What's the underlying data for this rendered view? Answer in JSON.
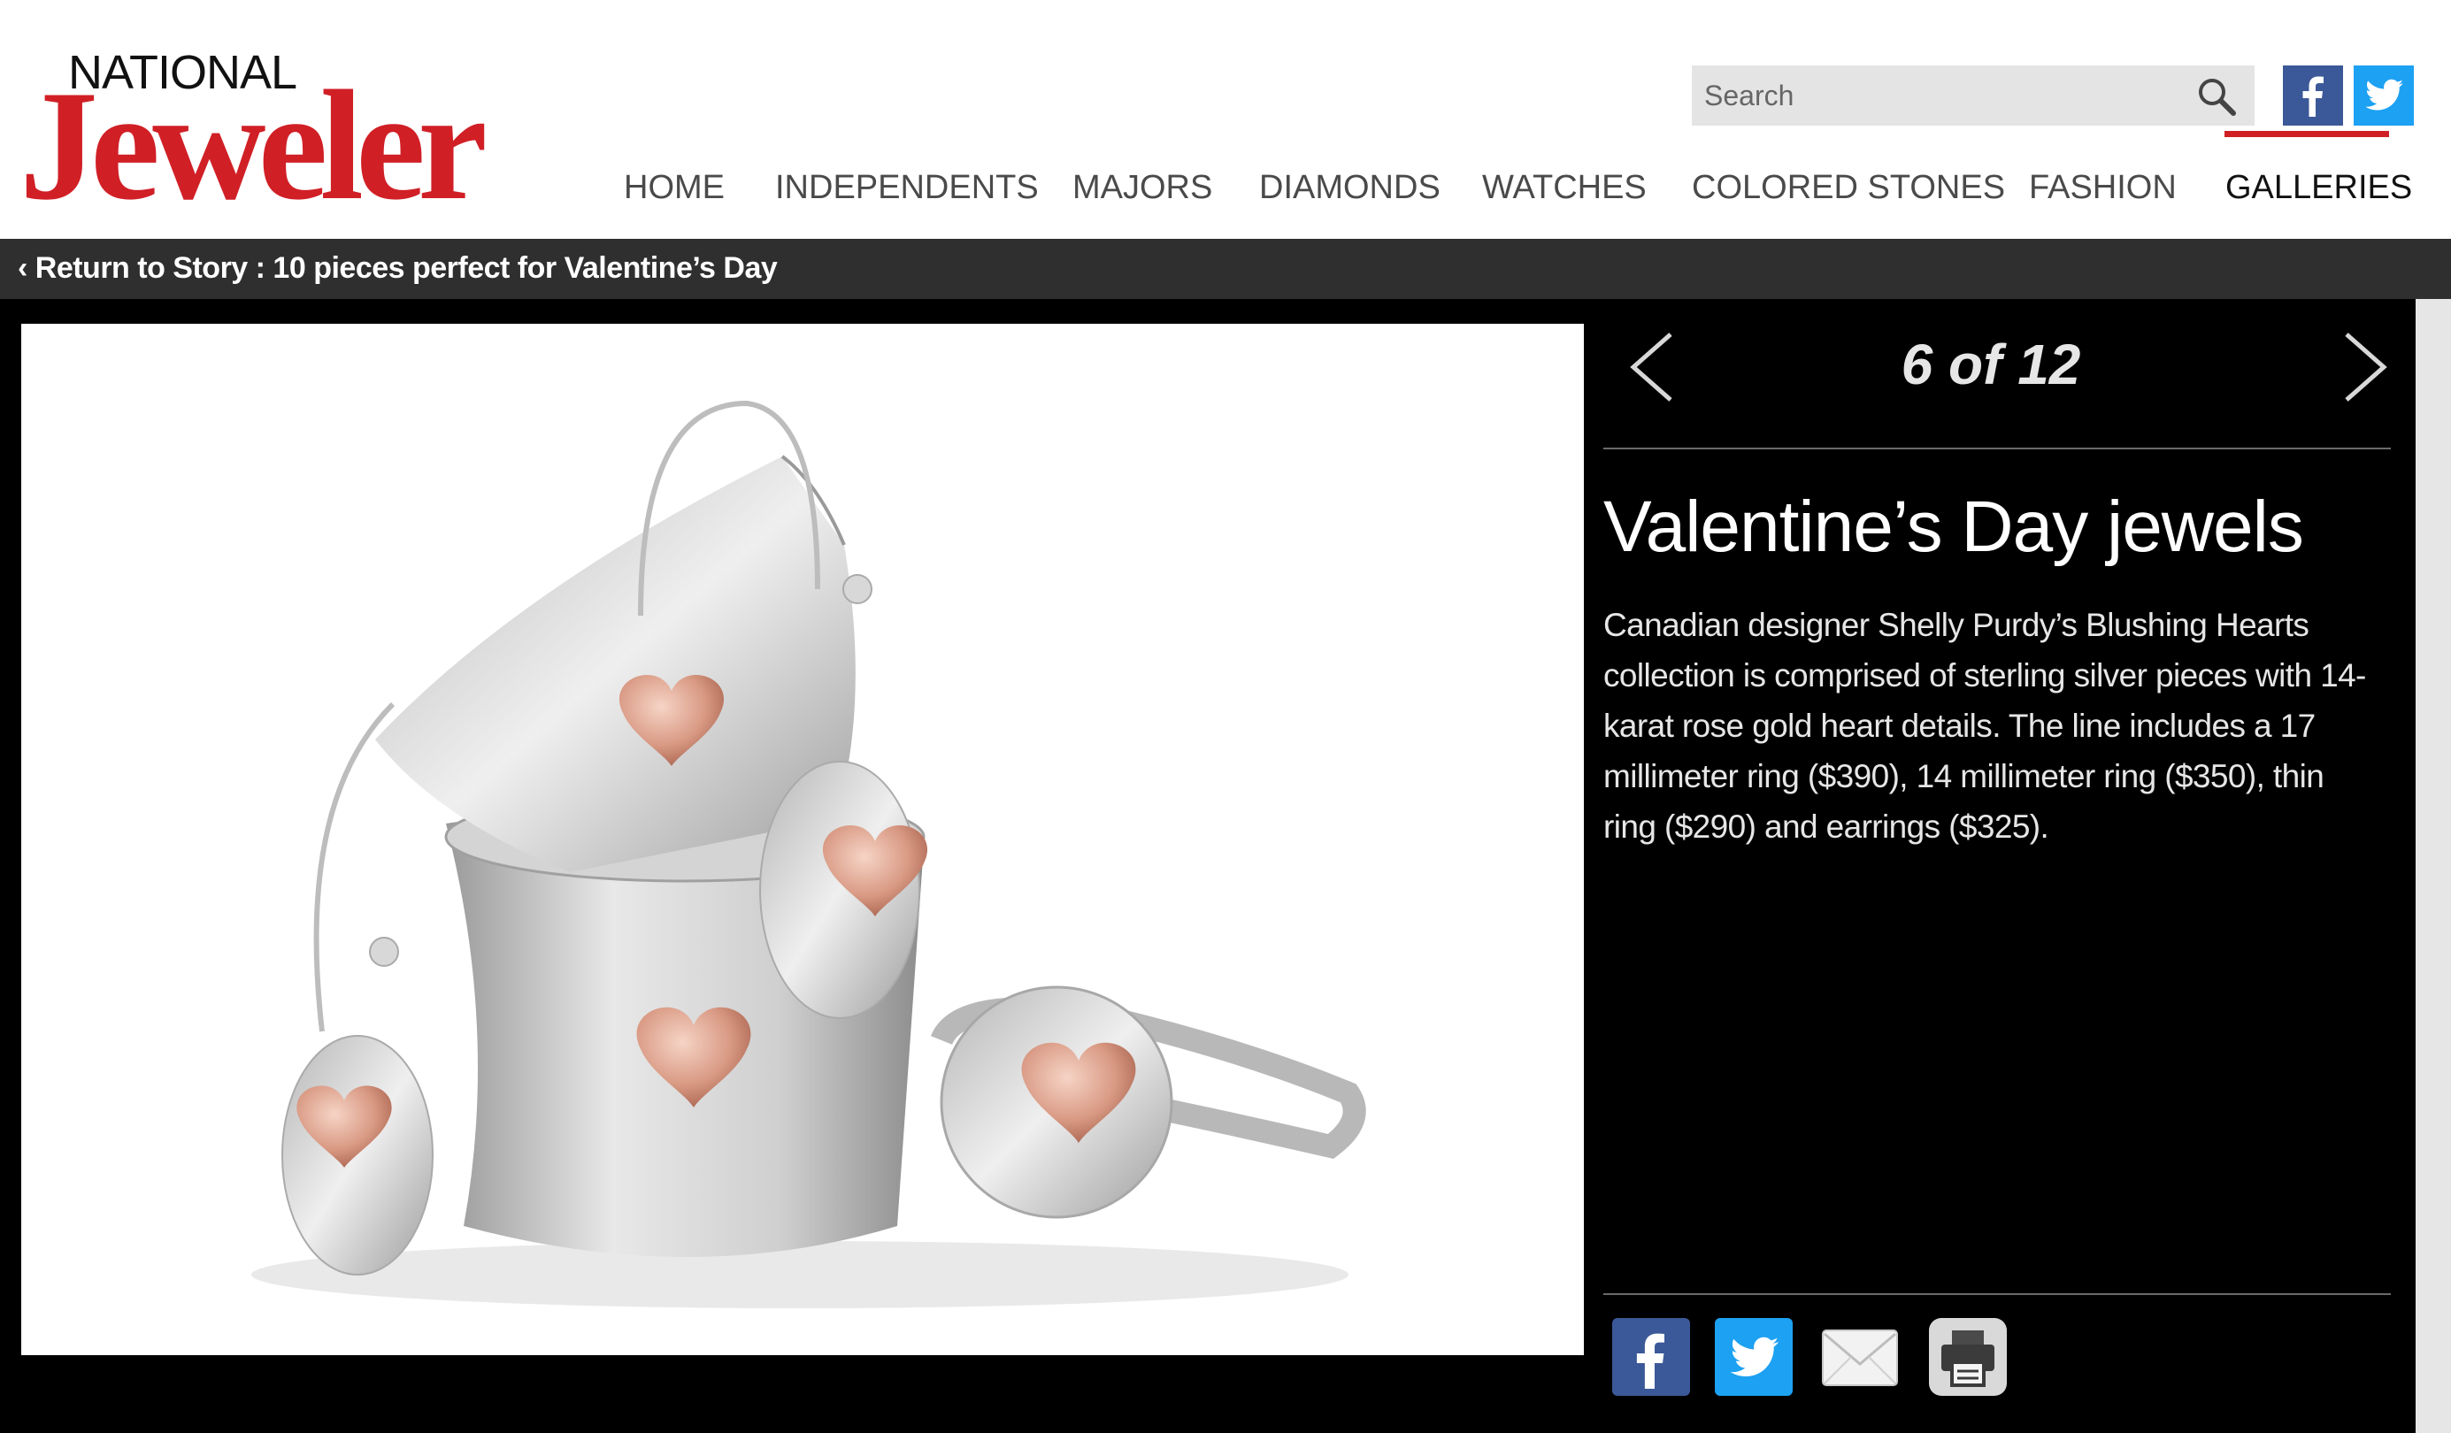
{
  "header": {
    "logo": {
      "top": "NATIONAL",
      "main": "Jeweler"
    },
    "search": {
      "placeholder": "Search"
    },
    "social": [
      "facebook-icon",
      "twitter-icon"
    ],
    "nav": [
      {
        "label": "HOME",
        "active": false
      },
      {
        "label": "INDEPENDENTS",
        "active": false
      },
      {
        "label": "MAJORS",
        "active": false
      },
      {
        "label": "DIAMONDS",
        "active": false
      },
      {
        "label": "WATCHES",
        "active": false
      },
      {
        "label": "COLORED STONES",
        "active": false
      },
      {
        "label": "FASHION",
        "active": false
      },
      {
        "label": "GALLERIES",
        "active": true
      }
    ]
  },
  "breadcrumb": {
    "text": "‹ Return to Story : 10 pieces perfect for Valentine’s Day"
  },
  "gallery": {
    "counter": "6 of 12",
    "title": "Valentine’s Day jewels",
    "description": "Canadian designer Shelly Purdy’s Blushing Hearts collection is comprised of sterling silver pieces with 14-karat rose gold heart details. The line includes a 17 millimeter ring ($390), 14 millimeter ring ($350), thin ring ($290) and earrings ($325).",
    "share": [
      "facebook-icon",
      "twitter-icon",
      "email-icon",
      "print-icon"
    ]
  },
  "colors": {
    "brand_red": "#d11f26",
    "bar_gray": "#2f2f2f",
    "gallery_bg": "#000000",
    "facebook": "#3b5998",
    "twitter": "#1da1f2"
  }
}
